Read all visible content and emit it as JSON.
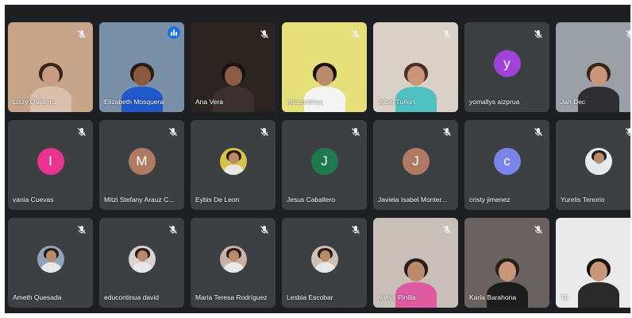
{
  "app": "Video meeting participant grid",
  "colors": {
    "tile_bg": "#3c4043",
    "grid_bg": "#1e1f22",
    "speaking_border": "#8ab4f8",
    "speaking_badge": "#1a73e8"
  },
  "participants": [
    {
      "name": "Lizzy Quintero",
      "kind": "video",
      "muted": true,
      "scene": {
        "bg": "#c6a58a",
        "skin": "#c79a82",
        "hair": "#3a2416",
        "shirt": "#d9c0ad"
      }
    },
    {
      "name": "Elizabeth Mosquera",
      "kind": "video",
      "muted": false,
      "speaking": true,
      "scene": {
        "bg": "#7a8fa8",
        "skin": "#8a5a3f",
        "hair": "#2b1b12",
        "shirt": "#1f58c8"
      }
    },
    {
      "name": "Ana Vera",
      "kind": "video",
      "muted": true,
      "scene": {
        "bg": "#2b2420",
        "skin": "#8a5e45",
        "hair": "#1a1210",
        "shirt": "#3a3030"
      }
    },
    {
      "name": "educontinua",
      "kind": "video",
      "muted": true,
      "scene": {
        "bg": "#e6e07a",
        "skin": "#b98a6c",
        "hair": "#1a1210",
        "shirt": "#f4f4f4"
      }
    },
    {
      "name": "Jubel Tuñon",
      "kind": "video",
      "muted": true,
      "scene": {
        "bg": "#d9d0c8",
        "skin": "#c9967a",
        "hair": "#4a2e20",
        "shirt": "#4fc1c3"
      }
    },
    {
      "name": "yomallys aizprua",
      "kind": "initial",
      "initial": "y",
      "color": "#a142d8",
      "muted": true
    },
    {
      "name": "Jan Dec",
      "kind": "video",
      "muted": true,
      "scene": {
        "bg": "#9aa0a6",
        "skin": "#c9967a",
        "hair": "#3a2416",
        "shirt": "#2f2f33"
      }
    },
    {
      "name": "vania Cuevas",
      "kind": "initial",
      "initial": "I",
      "color": "#e8348c",
      "muted": true
    },
    {
      "name": "Mitzi Stefany Arauz C...",
      "kind": "initial",
      "initial": "M",
      "color": "#b07a62",
      "muted": true
    },
    {
      "name": "Eybis De Leon",
      "kind": "photo",
      "color": "#d6c34a",
      "muted": true
    },
    {
      "name": "Jesus Caballero",
      "kind": "initial",
      "initial": "J",
      "color": "#1e7a4e",
      "muted": true
    },
    {
      "name": "Javiela Isabel Monter...",
      "kind": "initial",
      "initial": "J",
      "color": "#b07a62",
      "muted": true
    },
    {
      "name": "cristy jimenez",
      "kind": "initial",
      "initial": "c",
      "color": "#7986e8",
      "muted": true
    },
    {
      "name": "Yurelis Tenorio",
      "kind": "photo",
      "color": "#e6ecf4",
      "muted": true
    },
    {
      "name": "Ameth Quesada",
      "kind": "photo",
      "color": "#8fa4b8",
      "muted": true
    },
    {
      "name": "educontinua david",
      "kind": "photo",
      "color": "#d9d3cd",
      "muted": true
    },
    {
      "name": "Maria Teresa Rodríguez",
      "kind": "photo",
      "color": "#c9b1a8",
      "muted": true
    },
    {
      "name": "Lesbia Escobar",
      "kind": "photo",
      "color": "#d0c0b4",
      "muted": true
    },
    {
      "name": "Melva Pinilla",
      "kind": "video",
      "muted": true,
      "scene": {
        "bg": "#c8c0b8",
        "skin": "#b98a6c",
        "hair": "#2a1d17",
        "shirt": "#e05aa0"
      }
    },
    {
      "name": "Karla Barahona",
      "kind": "video",
      "muted": true,
      "scene": {
        "bg": "#6a6260",
        "skin": "#c9967a",
        "hair": "#2a1d17",
        "shirt": "#1c1c1c"
      }
    },
    {
      "name": "Tú",
      "kind": "video",
      "muted": true,
      "scene": {
        "bg": "#eaeaea",
        "skin": "#c9967a",
        "hair": "#1a1210",
        "shirt": "#2a2a2a"
      }
    }
  ]
}
